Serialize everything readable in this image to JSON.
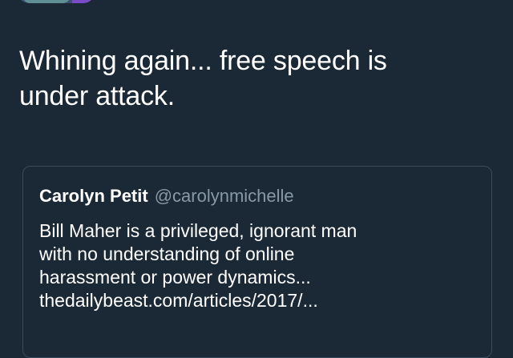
{
  "tweet": {
    "text": "Whining again... free speech is\nunder attack."
  },
  "quoted_tweet": {
    "author_name": "Carolyn Petit",
    "author_handle": "@carolynmichelle",
    "body_lines": [
      "Bill Maher is a privileged, ignorant man",
      "with no understanding of online",
      "harassment or power dynamics...",
      "thedailybeast.com/articles/2017/..."
    ]
  }
}
